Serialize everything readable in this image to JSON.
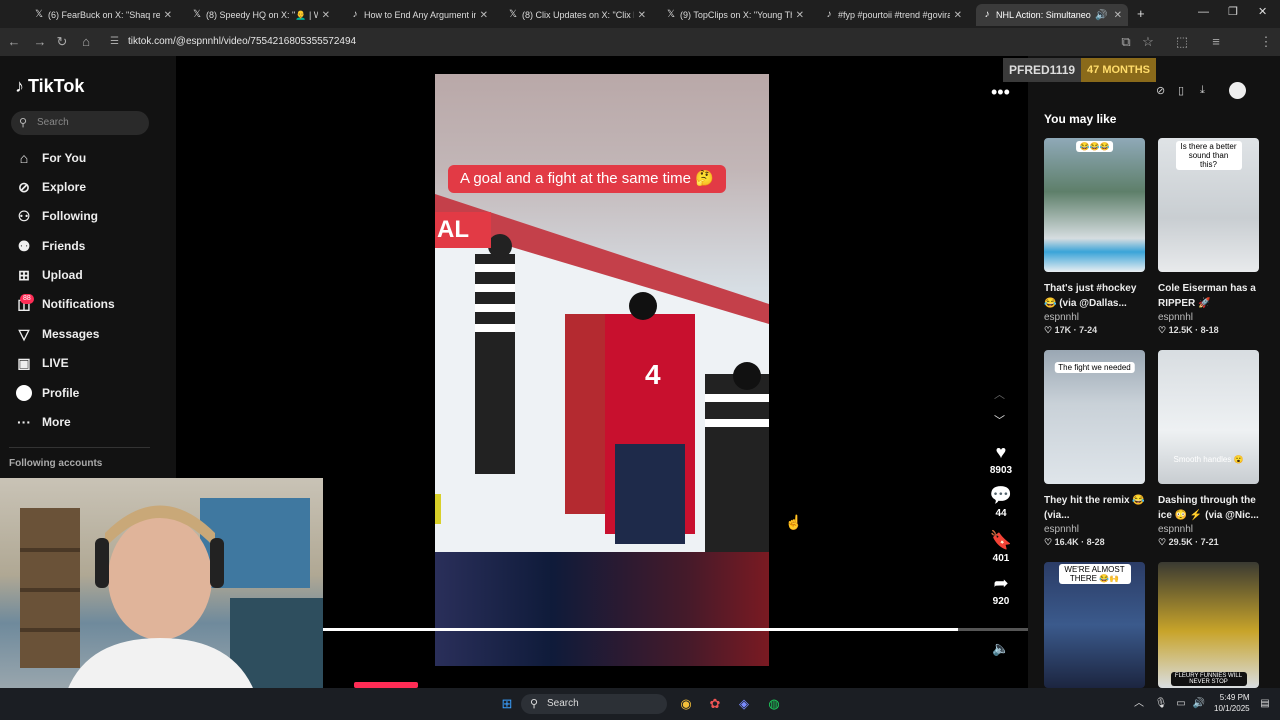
{
  "browser": {
    "tabs": [
      {
        "label": "(6) FearBuck on X: \"Shaq respo",
        "icon": "x-logo"
      },
      {
        "label": "(8) Speedy HQ on X: \"👨‍🦲 | WAT",
        "icon": "x-logo"
      },
      {
        "label": "How to End Any Argument in S",
        "icon": "tiktok-logo"
      },
      {
        "label": "(8) Clix Updates on X: \"Clix lists",
        "icon": "x-logo"
      },
      {
        "label": "(9) TopClips on X: \"Young Thug",
        "icon": "x-logo"
      },
      {
        "label": "#fyp #pourtoii #trend #goviral",
        "icon": "tiktok-logo"
      },
      {
        "label": "NHL Action: Simultaneous",
        "icon": "tiktok-logo"
      }
    ],
    "url": "tiktok.com/@espnnhl/video/7554216805355572494"
  },
  "sidebar": {
    "logo": "TikTok",
    "search_placeholder": "Search",
    "items": [
      {
        "label": "For You",
        "icon": "home-icon"
      },
      {
        "label": "Explore",
        "icon": "compass-icon"
      },
      {
        "label": "Following",
        "icon": "following-icon"
      },
      {
        "label": "Friends",
        "icon": "friends-icon"
      },
      {
        "label": "Upload",
        "icon": "upload-icon"
      },
      {
        "label": "Notifications",
        "icon": "notifications-icon"
      },
      {
        "label": "Messages",
        "icon": "messages-icon"
      },
      {
        "label": "LIVE",
        "icon": "live-icon"
      },
      {
        "label": "Profile",
        "icon": "profile-icon"
      },
      {
        "label": "More",
        "icon": "more-icon"
      }
    ],
    "notification_count": "88",
    "following_accounts": "Following accounts"
  },
  "video": {
    "caption": "A goal and a fight at the same time 🤔",
    "overlay_tag": "AL",
    "likes": "8903",
    "comments": "44",
    "saves": "401",
    "shares": "920",
    "progress": 0.9
  },
  "subscriber": {
    "name": "PFRED1119",
    "months": "47 MONTHS"
  },
  "recommendations": {
    "heading": "You may like",
    "cards": [
      {
        "overlay": "😂😂😂",
        "title": "That's just #hockey 😂 (via @Dallas...",
        "author": "espnnhl",
        "likes": "17K",
        "date": "7-24"
      },
      {
        "overlay": "Is there a better sound than this?",
        "title": "Cole Eiserman has a RIPPER 🚀 (@Baue...",
        "author": "espnnhl",
        "likes": "12.5K",
        "date": "8-18"
      },
      {
        "overlay": "The fight we needed",
        "title": "They hit the remix 😂 (via...",
        "author": "espnnhl",
        "likes": "16.4K",
        "date": "8-28"
      },
      {
        "overlay": "Smooth handles 😮",
        "title": "Dashing through the ice 😳 ⚡ (via @Nic...",
        "author": "espnnhl",
        "likes": "29.5K",
        "date": "7-21"
      },
      {
        "overlay": "WE'RE ALMOST THERE 😂🙌",
        "title": "",
        "author": "",
        "likes": "",
        "date": ""
      },
      {
        "overlay": "FLEURY FUNNIES WILL NEVER STOP",
        "title": "",
        "author": "",
        "likes": "",
        "date": ""
      }
    ]
  },
  "taskbar": {
    "search_placeholder": "Search",
    "time": "5:49 PM",
    "date": "10/1/2025"
  },
  "colors": {
    "accent": "#fe2c55",
    "caption_bg": "#e23a45"
  }
}
